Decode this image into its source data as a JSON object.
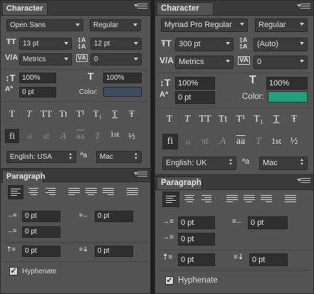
{
  "left": {
    "tab": "Character",
    "font_family": "Open Sans",
    "font_style": "Regular",
    "font_size": "13 pt",
    "leading": "12 pt",
    "kerning": "Metrics",
    "tracking": "0",
    "vscale": "100%",
    "hscale": "100%",
    "baseline": "0 pt",
    "color_label": "Color:",
    "color_hex": "#3b4d63",
    "language": "English: USA",
    "aa_label": "a",
    "antialias": "Mac",
    "para_tab": "Paragraph",
    "indent_left": "0 pt",
    "indent_right": "0 pt",
    "indent_first": "0 pt",
    "space_before": "0 pt",
    "space_after": "0 pt",
    "hyphenate": "Hyphenate"
  },
  "right": {
    "tab": "Character",
    "font_family": "Myriad Pro Regular",
    "font_style": "Regular",
    "font_size": "300 pt",
    "leading": "(Auto)",
    "kerning": "Metrics",
    "tracking": "0",
    "vscale": "100%",
    "hscale": "100%",
    "baseline": "0 pt",
    "color_label": "Color:",
    "color_hex": "#1fa07e",
    "language": "English: UK",
    "aa_label": "a",
    "antialias": "Mac",
    "para_tab": "Paragraph",
    "indent_left": "0 pt",
    "indent_right": "0 pt",
    "indent_first": "0 pt",
    "space_before": "0 pt",
    "space_after": "0 pt",
    "hyphenate": "Hyphenate"
  },
  "glyphs": {
    "type_styles": [
      "T",
      "T",
      "TT",
      "Tt",
      "T¹",
      "T₁",
      "T",
      "Ŧ"
    ],
    "opentype": [
      "fi",
      "ℴ",
      "st",
      "A",
      "aa",
      "T",
      "1st",
      "½"
    ]
  },
  "icons": [
    "font-size-icon",
    "leading-icon",
    "kerning-icon",
    "tracking-icon",
    "vertical-scale-icon",
    "horizontal-scale-icon",
    "baseline-shift-icon",
    "antialias-icon",
    "indent-left-icon",
    "indent-right-icon",
    "first-line-indent-icon",
    "space-before-icon",
    "space-after-icon",
    "panel-menu-icon",
    "checkmark-icon"
  ]
}
